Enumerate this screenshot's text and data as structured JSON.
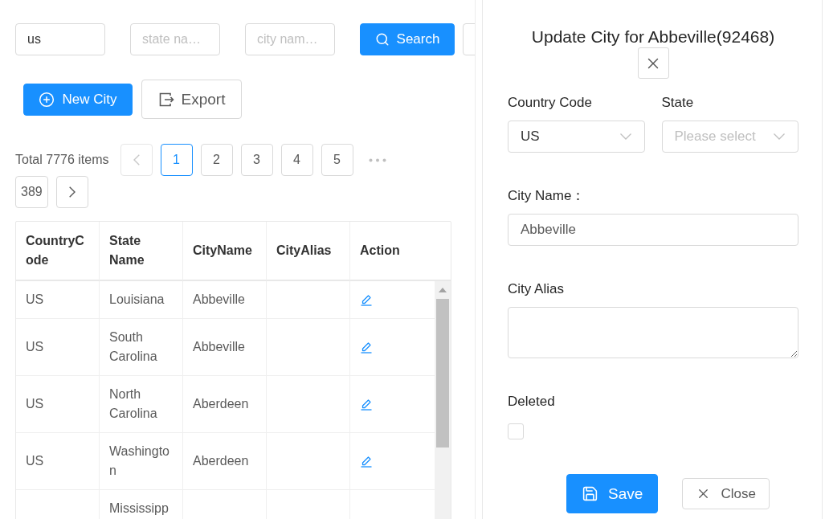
{
  "search_bar": {
    "fields": [
      {
        "value": "us"
      },
      {
        "placeholder": "state na…"
      },
      {
        "placeholder": "city nam…"
      }
    ],
    "search_button": "Search"
  },
  "toolbar": [
    {
      "label": "New City",
      "kind": "primary"
    },
    {
      "label": "Export",
      "kind": "default"
    }
  ],
  "pagination": {
    "total": "Total 7776 items",
    "items": [
      {
        "kind": "prev",
        "disabled": true
      },
      {
        "kind": "page",
        "label": "1",
        "selected": true
      },
      {
        "kind": "page",
        "label": "2",
        "selected": false
      },
      {
        "kind": "page",
        "label": "3",
        "selected": false
      },
      {
        "kind": "page",
        "label": "4",
        "selected": false
      },
      {
        "kind": "page",
        "label": "5",
        "selected": false
      },
      {
        "kind": "jump"
      },
      {
        "kind": "page",
        "label": "389",
        "selected": false
      },
      {
        "kind": "next",
        "disabled": false
      }
    ]
  },
  "table": {
    "columns": [
      "CountryCode",
      "State Name",
      "CityName",
      "CityAlias",
      "Action"
    ],
    "rows": [
      {
        "country_code": "US",
        "state_name": "Louisiana",
        "city_name": "Abbeville"
      },
      {
        "country_code": "US",
        "state_name": "South Carolina",
        "city_name": "Abbeville"
      },
      {
        "country_code": "US",
        "state_name": "North Carolina",
        "city_name": "Aberdeen"
      },
      {
        "country_code": "US",
        "state_name": "Washington",
        "city_name": "Aberdeen"
      },
      {
        "state_name": "Mississipp"
      }
    ]
  },
  "drawer": {
    "title": "Update City for Abbeville(92468)",
    "form_rows": [
      {
        "fields": [
          {
            "kind": "select",
            "label": "Country Code",
            "value": "US"
          },
          {
            "kind": "select",
            "label": "State",
            "placeholder": "Please select"
          }
        ]
      },
      {
        "fields": [
          {
            "kind": "input",
            "label": "City Name：",
            "value": "Abbeville"
          }
        ]
      },
      {
        "fields": [
          {
            "kind": "textarea",
            "label": "City Alias"
          }
        ]
      },
      {
        "fields": [
          {
            "kind": "checkbox",
            "label": "Deleted",
            "checked": false
          }
        ]
      }
    ],
    "buttons": [
      {
        "label": "Save",
        "kind": "primary"
      },
      {
        "label": "Close",
        "kind": "default"
      }
    ]
  }
}
